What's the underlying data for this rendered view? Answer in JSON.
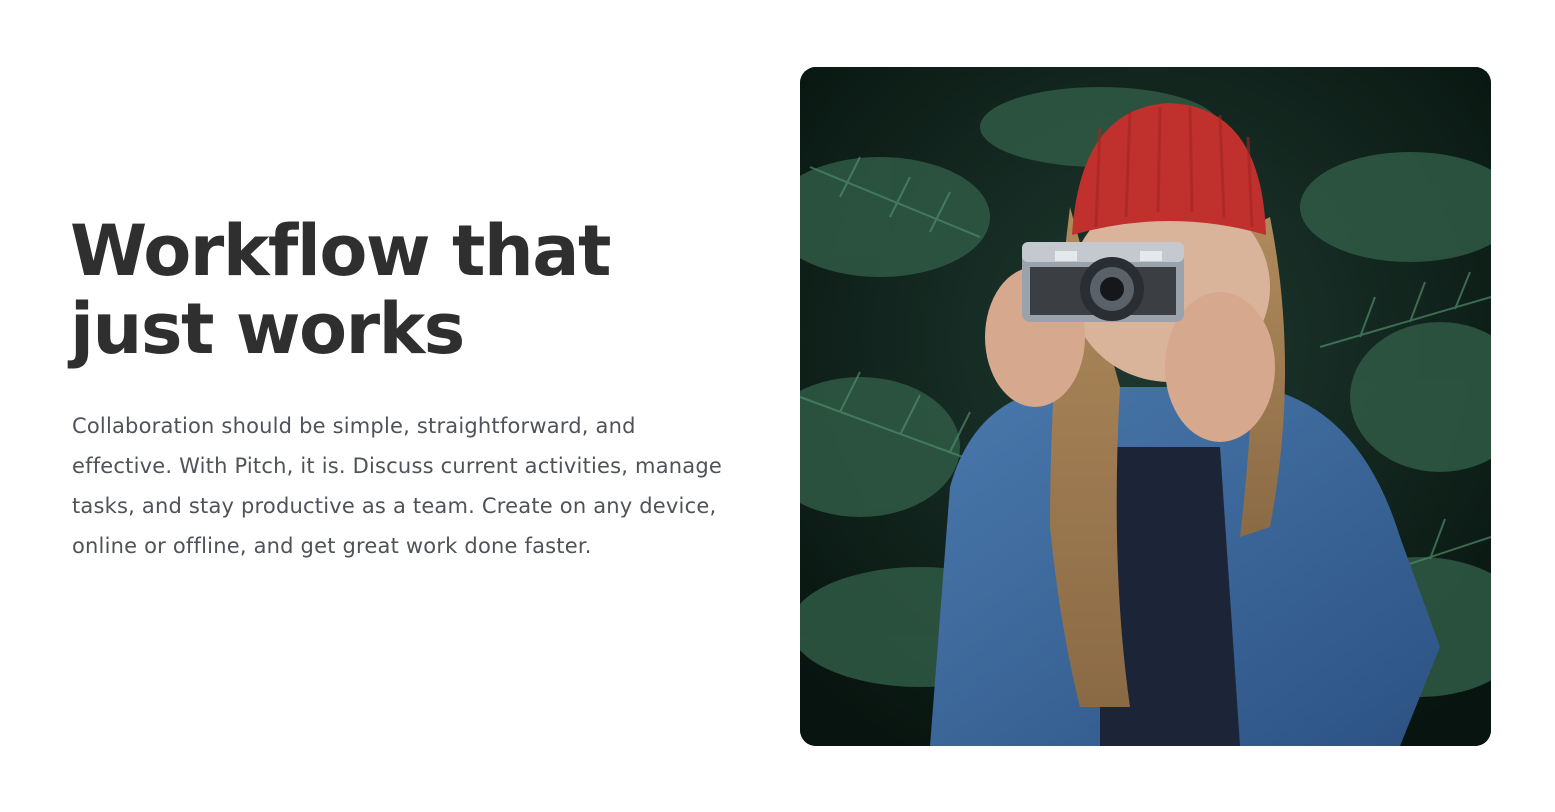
{
  "feature": {
    "headline_line1": "Workflow that",
    "headline_line2": "just works",
    "body": "Collaboration should be simple, straightforward, and effective. With Pitch, it is. Discuss current activities, manage tasks, and stay productive as a team. Create on any device, online or offline, and get great work done faster."
  },
  "photo": {
    "subject": "person in red beanie photographing with vintage camera",
    "icon": "photo-image"
  },
  "colors": {
    "heading": "#2f2f2f",
    "body": "#4f5258",
    "background": "#ffffff"
  }
}
